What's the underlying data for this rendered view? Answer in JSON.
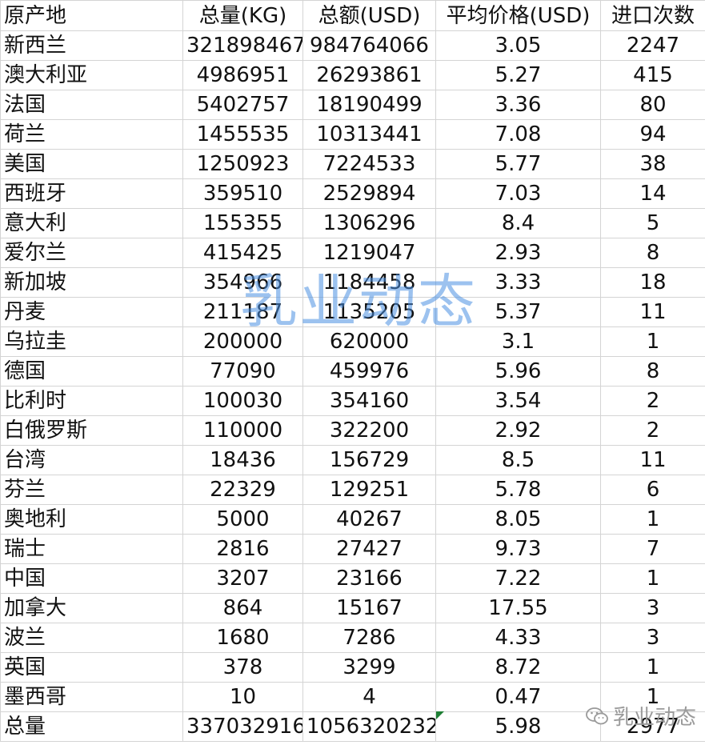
{
  "columns": [
    "原产地",
    "总量(KG)",
    "总额(USD)",
    "平均价格(USD)",
    "进口次数"
  ],
  "rows": [
    [
      "新西兰",
      "321898467",
      "984764066",
      "3.05",
      "2247"
    ],
    [
      "澳大利亚",
      "4986951",
      "26293861",
      "5.27",
      "415"
    ],
    [
      "法国",
      "5402757",
      "18190499",
      "3.36",
      "80"
    ],
    [
      "荷兰",
      "1455535",
      "10313441",
      "7.08",
      "94"
    ],
    [
      "美国",
      "1250923",
      "7224533",
      "5.77",
      "38"
    ],
    [
      "西班牙",
      "359510",
      "2529894",
      "7.03",
      "14"
    ],
    [
      "意大利",
      "155355",
      "1306296",
      "8.4",
      "5"
    ],
    [
      "爱尔兰",
      "415425",
      "1219047",
      "2.93",
      "8"
    ],
    [
      "新加坡",
      "354966",
      "1184458",
      "3.33",
      "18"
    ],
    [
      "丹麦",
      "211187",
      "1135205",
      "5.37",
      "11"
    ],
    [
      "乌拉圭",
      "200000",
      "620000",
      "3.1",
      "1"
    ],
    [
      "德国",
      "77090",
      "459976",
      "5.96",
      "8"
    ],
    [
      "比利时",
      "100030",
      "354160",
      "3.54",
      "2"
    ],
    [
      "白俄罗斯",
      "110000",
      "322200",
      "2.92",
      "2"
    ],
    [
      "台湾",
      "18436",
      "156729",
      "8.5",
      "11"
    ],
    [
      "芬兰",
      "22329",
      "129251",
      "5.78",
      "6"
    ],
    [
      "奥地利",
      "5000",
      "40267",
      "8.05",
      "1"
    ],
    [
      "瑞士",
      "2816",
      "27427",
      "9.73",
      "7"
    ],
    [
      "中国",
      "3207",
      "23166",
      "7.22",
      "1"
    ],
    [
      "加拿大",
      "864",
      "15167",
      "17.55",
      "3"
    ],
    [
      "波兰",
      "1680",
      "7286",
      "4.33",
      "3"
    ],
    [
      "英国",
      "378",
      "3299",
      "8.72",
      "1"
    ],
    [
      "墨西哥",
      "10",
      "4",
      "0.47",
      "1"
    ],
    [
      "总量",
      "337032916",
      "1056320232",
      "5.98",
      "2977"
    ]
  ],
  "watermark": "乳业动态",
  "wechat_label": "乳业动态",
  "icons": {
    "wechat": "wechat-icon"
  }
}
